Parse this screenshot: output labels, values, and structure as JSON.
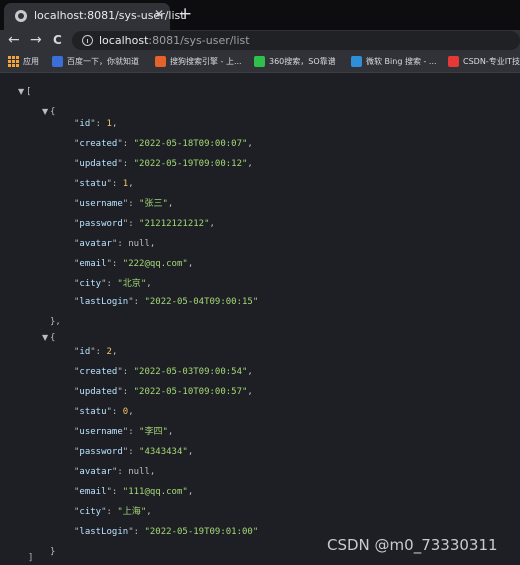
{
  "tab": {
    "title": "localhost:8081/sys-user/list",
    "close": "✕",
    "newtab": "+"
  },
  "toolbar": {
    "back": "←",
    "forward": "→",
    "reload": "C",
    "url_host": "localhost",
    "url_rest": ":8081/sys-user/list"
  },
  "bookmarks": [
    {
      "label": "应用",
      "color": "#f2a33a"
    },
    {
      "label": "百度一下，你就知道",
      "color": "#3b6fd8"
    },
    {
      "label": "搜狗搜索引擎 - 上...",
      "color": "#e5632b"
    },
    {
      "label": "360搜索，SO靠谱",
      "color": "#2fbf4a"
    },
    {
      "label": "微软 Bing 搜索 - ...",
      "color": "#2e8fd8"
    },
    {
      "label": "CSDN-专业IT技...",
      "color": "#e53935"
    }
  ],
  "json_lines": [
    {
      "text": "[",
      "kind": "brace"
    },
    {
      "text": "{",
      "kind": "brace"
    },
    {
      "key": "id",
      "value": "1",
      "type": "num"
    },
    {
      "key": "created",
      "value": "2022-05-18T09:00:07",
      "type": "str"
    },
    {
      "key": "updated",
      "value": "2022-05-19T09:00:12",
      "type": "str"
    },
    {
      "key": "statu",
      "value": "1",
      "type": "num"
    },
    {
      "key": "username",
      "value": "张三",
      "type": "str"
    },
    {
      "key": "password",
      "value": "21212121212",
      "type": "str"
    },
    {
      "key": "avatar",
      "value": "null",
      "type": "null"
    },
    {
      "key": "email",
      "value": "222@qq.com",
      "type": "str"
    },
    {
      "key": "city",
      "value": "北京",
      "type": "str"
    },
    {
      "key": "lastLogin",
      "value": "2022-05-04T09:00:15",
      "type": "str",
      "last": true
    },
    {
      "text": "},",
      "kind": "brace"
    },
    {
      "text": "{",
      "kind": "brace"
    },
    {
      "key": "id",
      "value": "2",
      "type": "num"
    },
    {
      "key": "created",
      "value": "2022-05-03T09:00:54",
      "type": "str"
    },
    {
      "key": "updated",
      "value": "2022-05-10T09:00:57",
      "type": "str"
    },
    {
      "key": "statu",
      "value": "0",
      "type": "num"
    },
    {
      "key": "username",
      "value": "李四",
      "type": "str"
    },
    {
      "key": "password",
      "value": "4343434",
      "type": "str"
    },
    {
      "key": "avatar",
      "value": "null",
      "type": "null"
    },
    {
      "key": "email",
      "value": "111@qq.com",
      "type": "str"
    },
    {
      "key": "city",
      "value": "上海",
      "type": "str"
    },
    {
      "key": "lastLogin",
      "value": "2022-05-19T09:01:00",
      "type": "str",
      "last": true
    },
    {
      "text": "}",
      "kind": "brace"
    },
    {
      "text": "]",
      "kind": "brace"
    }
  ],
  "watermark": "CSDN @m0_73330311"
}
